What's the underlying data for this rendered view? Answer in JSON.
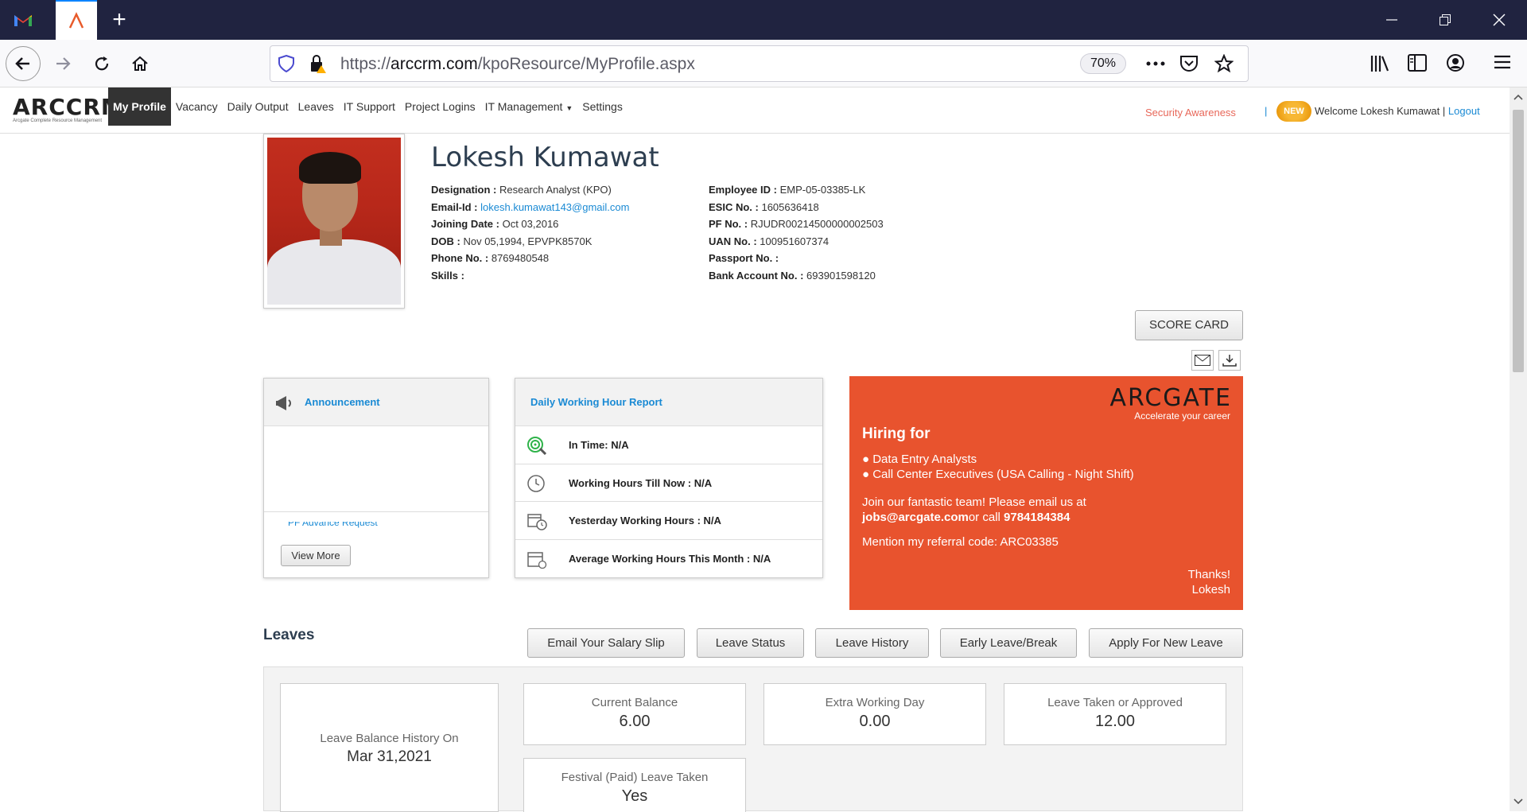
{
  "browser": {
    "url_prefix": "https://",
    "url_domain": "arccrm.com",
    "url_path": "/kpoResource/MyProfile.aspx",
    "zoom": "70%"
  },
  "site": {
    "logo": "ARCCRM",
    "logo_sub": "Arcgate Complete Resource Management",
    "menu": [
      "My Profile",
      "Vacancy",
      "Daily Output",
      "Leaves",
      "IT Support",
      "Project Logins",
      "IT Management",
      "Settings"
    ],
    "security_awareness": "Security Awareness",
    "separator": "|",
    "new_badge": "NEW",
    "welcome": "Welcome Lokesh Kumawat",
    "welcome_sep": "|",
    "logout": "Logout"
  },
  "profile": {
    "name": "Lokesh Kumawat",
    "left_fields": [
      {
        "k": "Designation :",
        "v": "Research Analyst (KPO)"
      },
      {
        "k": "Email-Id :",
        "v": "lokesh.kumawat143@gmail.com"
      },
      {
        "k": "Joining Date :",
        "v": "Oct 03,2016"
      },
      {
        "k": "DOB :",
        "v": "Nov 05,1994, EPVPK8570K"
      },
      {
        "k": "Phone No. :",
        "v": "8769480548"
      },
      {
        "k": "Skills :",
        "v": ""
      }
    ],
    "right_fields": [
      {
        "k": "Employee ID :",
        "v": "EMP-05-03385-LK"
      },
      {
        "k": "ESIC No. :",
        "v": "1605636418"
      },
      {
        "k": "PF No. :",
        "v": "RJUDR00214500000002503"
      },
      {
        "k": "UAN No. :",
        "v": "100951607374"
      },
      {
        "k": "Passport No. :",
        "v": ""
      },
      {
        "k": "Bank Account No. :",
        "v": "693901598120"
      }
    ],
    "score_card": "SCORE CARD"
  },
  "announcement": {
    "title": "Announcement",
    "item": "PF Advance Request",
    "view_more": "View More"
  },
  "whr": {
    "title": "Daily Working Hour Report",
    "rows": [
      "In Time: N/A",
      "Working Hours Till Now : N/A",
      "Yesterday Working Hours : N/A",
      "Average Working Hours This Month : N/A"
    ]
  },
  "hiring": {
    "brand": "ARCGATE",
    "tagline": "Accelerate your career",
    "heading": "Hiring for",
    "bullet1": "● Data Entry Analysts",
    "bullet2": "● Call Center Executives (USA Calling - Night Shift)",
    "join": "Join our fantastic team! Please email us at",
    "email": "jobs@arcgate.com",
    "or_call": "or call",
    "phone": "9784184384",
    "referral": "Mention my referral code: ARC03385",
    "thanks": "Thanks!",
    "signoff": "Lokesh",
    "bg_color": "#e8532e"
  },
  "leaves": {
    "title": "Leaves",
    "buttons": [
      "Email Your Salary Slip",
      "Leave Status",
      "Leave History",
      "Early Leave/Break",
      "Apply For New Leave"
    ],
    "history_label": "Leave Balance History On",
    "history_date": "Mar 31,2021",
    "cards": [
      {
        "label": "Current Balance",
        "value": "6.00"
      },
      {
        "label": "Extra Working Day",
        "value": "0.00"
      },
      {
        "label": "Leave Taken or Approved",
        "value": "12.00"
      },
      {
        "label": "Festival (Paid) Leave Taken",
        "value": "Yes"
      }
    ]
  }
}
